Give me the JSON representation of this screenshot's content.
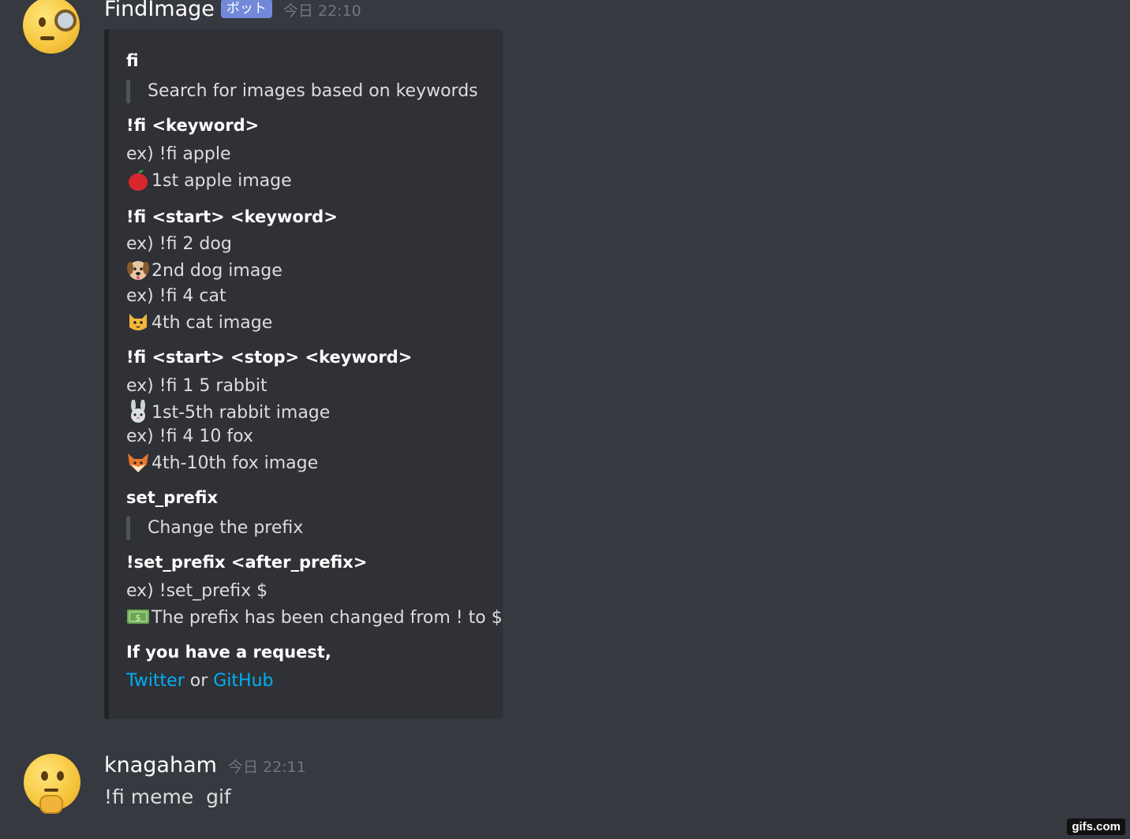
{
  "bot_message": {
    "username": "FindImage",
    "bot_tag": "ボット",
    "timestamp": "今日 22:10",
    "avatar_icon": "face-with-monocle-icon"
  },
  "embed": {
    "sections": {
      "fi_title": "fi",
      "fi_desc": "Search for images based on keywords",
      "cmd1_title": "!fi <keyword>",
      "cmd1_ex1": "ex) !fi apple",
      "cmd1_res1": "1st apple image",
      "cmd2_title": "!fi <start> <keyword>",
      "cmd2_ex1": "ex) !fi 2 dog",
      "cmd2_res1": "2nd dog image",
      "cmd2_ex2": "ex) !fi 4 cat",
      "cmd2_res2": "4th cat image",
      "cmd3_title": "!fi <start> <stop> <keyword>",
      "cmd3_ex1": "ex) !fi 1 5 rabbit",
      "cmd3_res1": "1st-5th rabbit image",
      "cmd3_ex2": "ex) !fi 4 10 fox",
      "cmd3_res2": "4th-10th fox image",
      "prefix_title": "set_prefix",
      "prefix_desc": "Change the prefix",
      "cmd4_title": "!set_prefix <after_prefix>",
      "cmd4_ex1": "ex) !set_prefix $",
      "cmd4_res1": "The prefix has been changed from ! to $",
      "request_title": "If you have a request,",
      "twitter_link": "Twitter",
      "or_text": " or ",
      "github_link": "GitHub"
    },
    "icons": [
      "apple-icon",
      "dog-face-icon",
      "cat-face-icon",
      "rabbit-face-icon",
      "fox-face-icon",
      "dollar-banknote-icon"
    ],
    "accent_color": "#202225",
    "link_color": "#00b0f4"
  },
  "user_message": {
    "username": "knagaham",
    "timestamp": "今日 22:11",
    "text": "!fi meme  gif",
    "avatar_icon": "thinking-face-icon"
  },
  "watermark": "gifs.com"
}
